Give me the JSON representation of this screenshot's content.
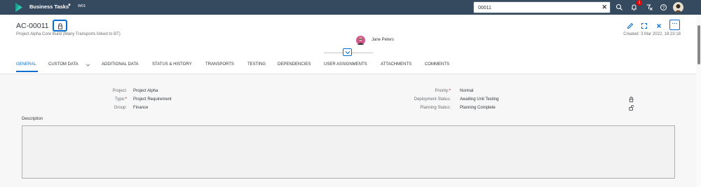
{
  "shell": {
    "app_title": "Business Tasks",
    "workspace": "W01",
    "search_value": "00011",
    "notification_count": "1",
    "icons": [
      "sap-logo-icon",
      "search-icon",
      "bell-icon",
      "filter-icon",
      "help-icon",
      "user-avatar"
    ]
  },
  "header": {
    "object_id": "AC-00011",
    "subtitle": "Project Alpha Core Build (Many Transports linked to BT)",
    "person_name": "Jane Peters",
    "created": "Created: 3 Mar 2022, 18:23:18"
  },
  "tabs": [
    {
      "label": "GENERAL"
    },
    {
      "label": "CUSTOM DATA"
    },
    {
      "label": "ADDITIONAL DATA"
    },
    {
      "label": "STATUS & HISTORY"
    },
    {
      "label": "TRANSPORTS"
    },
    {
      "label": "TESTING"
    },
    {
      "label": "DEPENDENCIES"
    },
    {
      "label": "USER ASSIGNMENTS"
    },
    {
      "label": "ATTACHMENTS"
    },
    {
      "label": "COMMENTS"
    }
  ],
  "form": {
    "left": [
      {
        "label": "Project:",
        "value": "Project Alpha",
        "required": ""
      },
      {
        "label": "Type:",
        "value": "Project Requirement",
        "required": "*"
      },
      {
        "label": "Group:",
        "value": "Finance",
        "required": ""
      }
    ],
    "right": [
      {
        "label": "Priority:",
        "value": "Normal",
        "required": "*"
      },
      {
        "label": "Deployment Status:",
        "value": "Awaiting Unit Testing",
        "required": ""
      },
      {
        "label": "Planning Status:",
        "value": "Planning Complete",
        "required": ""
      }
    ],
    "description_label": "Description"
  },
  "colors": {
    "shell": "#354a5f",
    "accent": "#0a6ed1",
    "required": "#bb0000"
  }
}
